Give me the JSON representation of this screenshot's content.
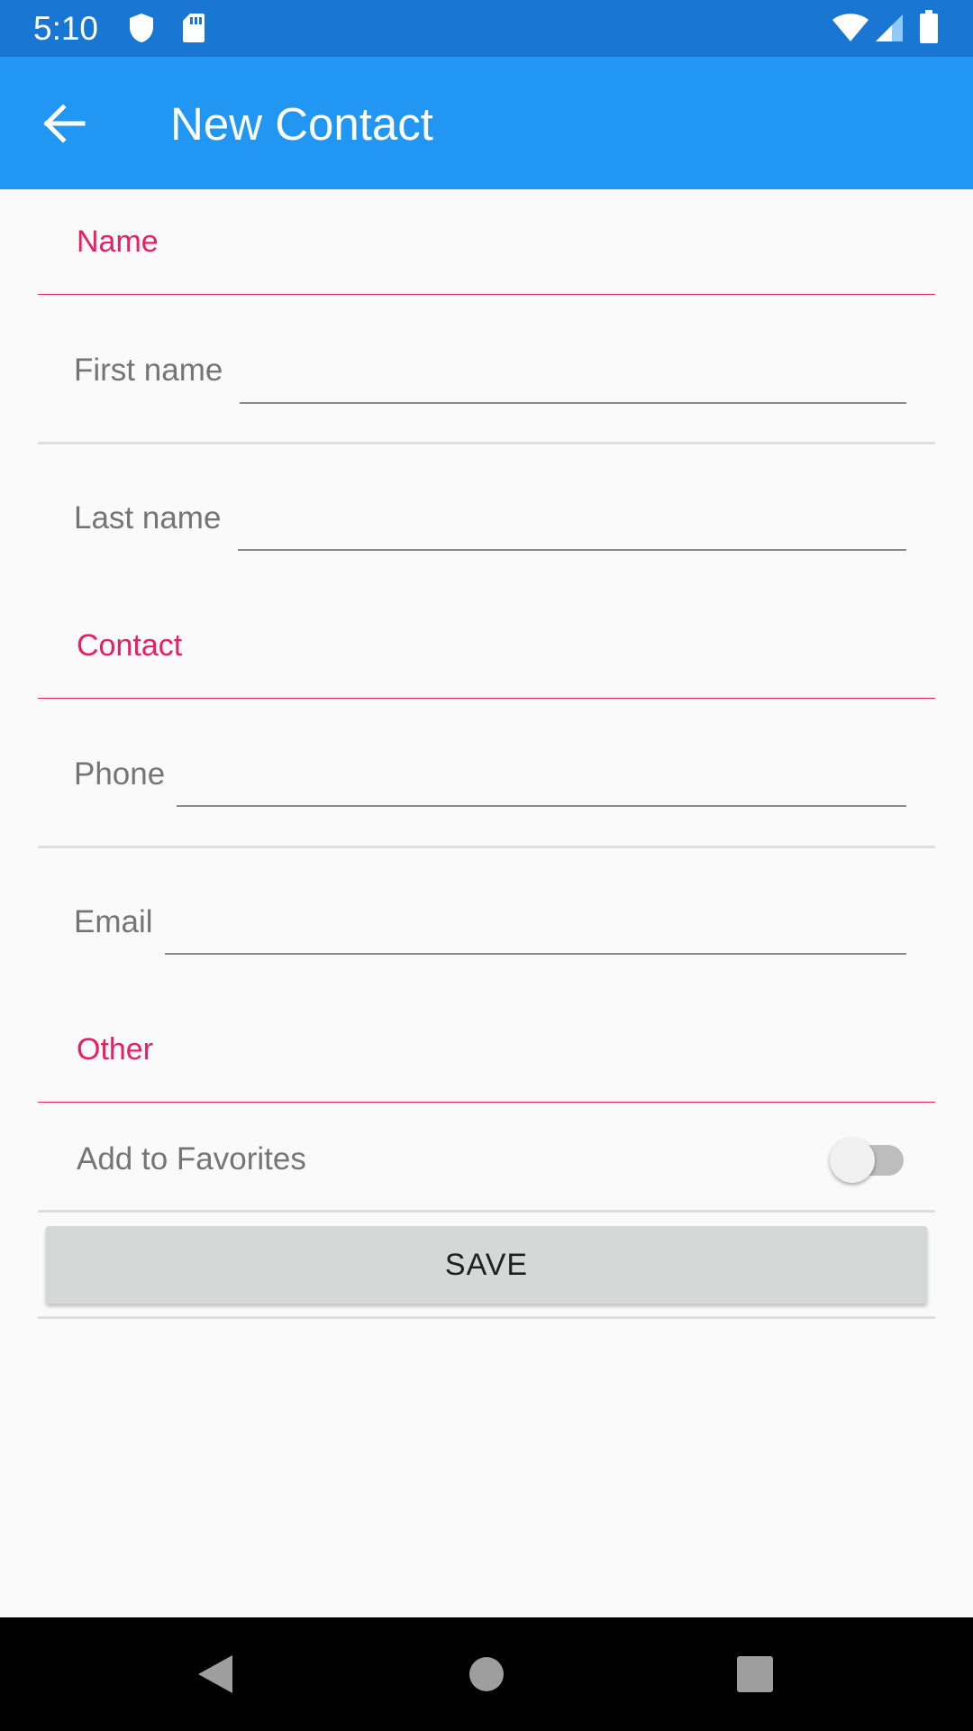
{
  "status_bar": {
    "time": "5:10",
    "icons": [
      "shield-icon",
      "sd-card-icon",
      "wifi-icon",
      "signal-icon",
      "battery-icon"
    ]
  },
  "app_bar": {
    "title": "New Contact",
    "back_icon": "arrow-back-icon",
    "color": "#2196f3"
  },
  "sections": {
    "name": {
      "title": "Name",
      "first_name": {
        "label": "First name",
        "value": ""
      },
      "last_name": {
        "label": "Last name",
        "value": ""
      }
    },
    "contact": {
      "title": "Contact",
      "phone": {
        "label": "Phone",
        "value": ""
      },
      "email": {
        "label": "Email",
        "value": ""
      }
    },
    "other": {
      "title": "Other",
      "favorites": {
        "label": "Add to Favorites",
        "on": false
      }
    }
  },
  "save_button": {
    "label": "SAVE"
  },
  "nav_bar": {
    "icons": [
      "back-triangle-icon",
      "home-circle-icon",
      "recents-square-icon"
    ]
  },
  "colors": {
    "accent": "#e91e63",
    "status_bar": "#1976d2"
  }
}
